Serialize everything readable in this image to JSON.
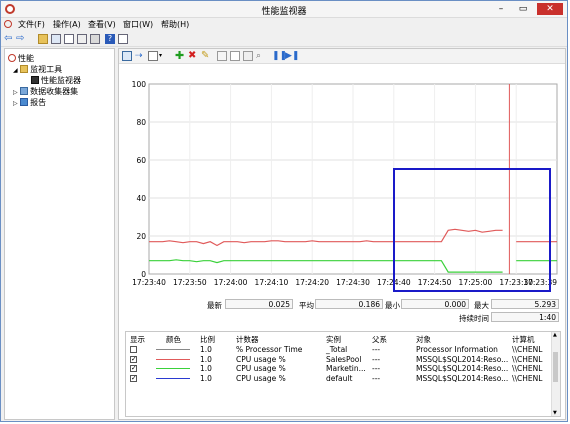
{
  "window": {
    "title": "性能监视器"
  },
  "menu": [
    "文件(F)",
    "操作(A)",
    "查看(V)",
    "窗口(W)",
    "帮助(H)"
  ],
  "tree": {
    "root": "性能",
    "monitoring_tools": "监视工具",
    "performance_monitor": "性能监视器",
    "data_collector_sets": "数据收集器集",
    "reports": "报告"
  },
  "chart_data": {
    "type": "line",
    "ylim": [
      0,
      100
    ],
    "yticks": [
      "0",
      "20",
      "40",
      "60",
      "80",
      "100"
    ],
    "xticks": [
      "17:23:40",
      "17:23:50",
      "17:24:00",
      "17:24:10",
      "17:24:20",
      "17:24:30",
      "17:24:40",
      "17:24:50",
      "17:25:00",
      "17:23:30",
      "17:23:39"
    ],
    "series": [
      {
        "color": "#e05a5a",
        "values": [
          17,
          17,
          17,
          17.5,
          17,
          16.5,
          17,
          17,
          16,
          17,
          15,
          17,
          17,
          17,
          16.5,
          17,
          17,
          17,
          17.5,
          17.5,
          17,
          17,
          17,
          17,
          17.5,
          17,
          17,
          17,
          17,
          17,
          17,
          17,
          17.5,
          17,
          17,
          17,
          17,
          17,
          17,
          17,
          17,
          17,
          17,
          17,
          23,
          23.5,
          23,
          22.5,
          23,
          22,
          22.5,
          23,
          23,
          null,
          17,
          17,
          17,
          17,
          17,
          17,
          17
        ]
      },
      {
        "color": "#3ad13a",
        "values": [
          7,
          7,
          7,
          7,
          7.5,
          7,
          7,
          6.5,
          7,
          7,
          6,
          7,
          7,
          7,
          7,
          7,
          7,
          7,
          7,
          7,
          7,
          7,
          7,
          7,
          7,
          7,
          7,
          7,
          7,
          7,
          7,
          7,
          7,
          7,
          7,
          7,
          7,
          7,
          7,
          7,
          7,
          7,
          7,
          7,
          1,
          1,
          1,
          1,
          1,
          1,
          1,
          1,
          1,
          null,
          7,
          7,
          7,
          7,
          7,
          7,
          7
        ]
      }
    ]
  },
  "stats": {
    "last_label": "最新",
    "last": "0.025",
    "avg_label": "平均",
    "avg": "0.186",
    "min_label": "最小",
    "min": "0.000",
    "max_label": "最大",
    "max": "5.293",
    "duration_label": "持续时间",
    "duration": "1:40"
  },
  "legend": {
    "headers": {
      "show": "显示",
      "color": "颜色",
      "scale": "比例",
      "counter": "计数器",
      "instance": "实例",
      "parent": "父系",
      "object": "对象",
      "computer": "计算机"
    },
    "rows": [
      {
        "checked": false,
        "color": "#888888",
        "scale": "1.0",
        "counter": "% Processor Time",
        "instance": "_Total",
        "parent": "---",
        "object": "Processor Information",
        "computer": "\\\\CHENL"
      },
      {
        "checked": true,
        "color": "#e05a5a",
        "scale": "1.0",
        "counter": "CPU usage %",
        "instance": "SalesPool",
        "parent": "---",
        "object": "MSSQL$SQL2014:Reso...",
        "computer": "\\\\CHENL"
      },
      {
        "checked": true,
        "color": "#3ad13a",
        "scale": "1.0",
        "counter": "CPU usage %",
        "instance": "Marketin...",
        "parent": "---",
        "object": "MSSQL$SQL2014:Reso...",
        "computer": "\\\\CHENL"
      },
      {
        "checked": true,
        "color": "#2a3ad1",
        "scale": "1.0",
        "counter": "CPU usage %",
        "instance": "default",
        "parent": "---",
        "object": "MSSQL$SQL2014:Reso...",
        "computer": "\\\\CHENL"
      }
    ]
  }
}
